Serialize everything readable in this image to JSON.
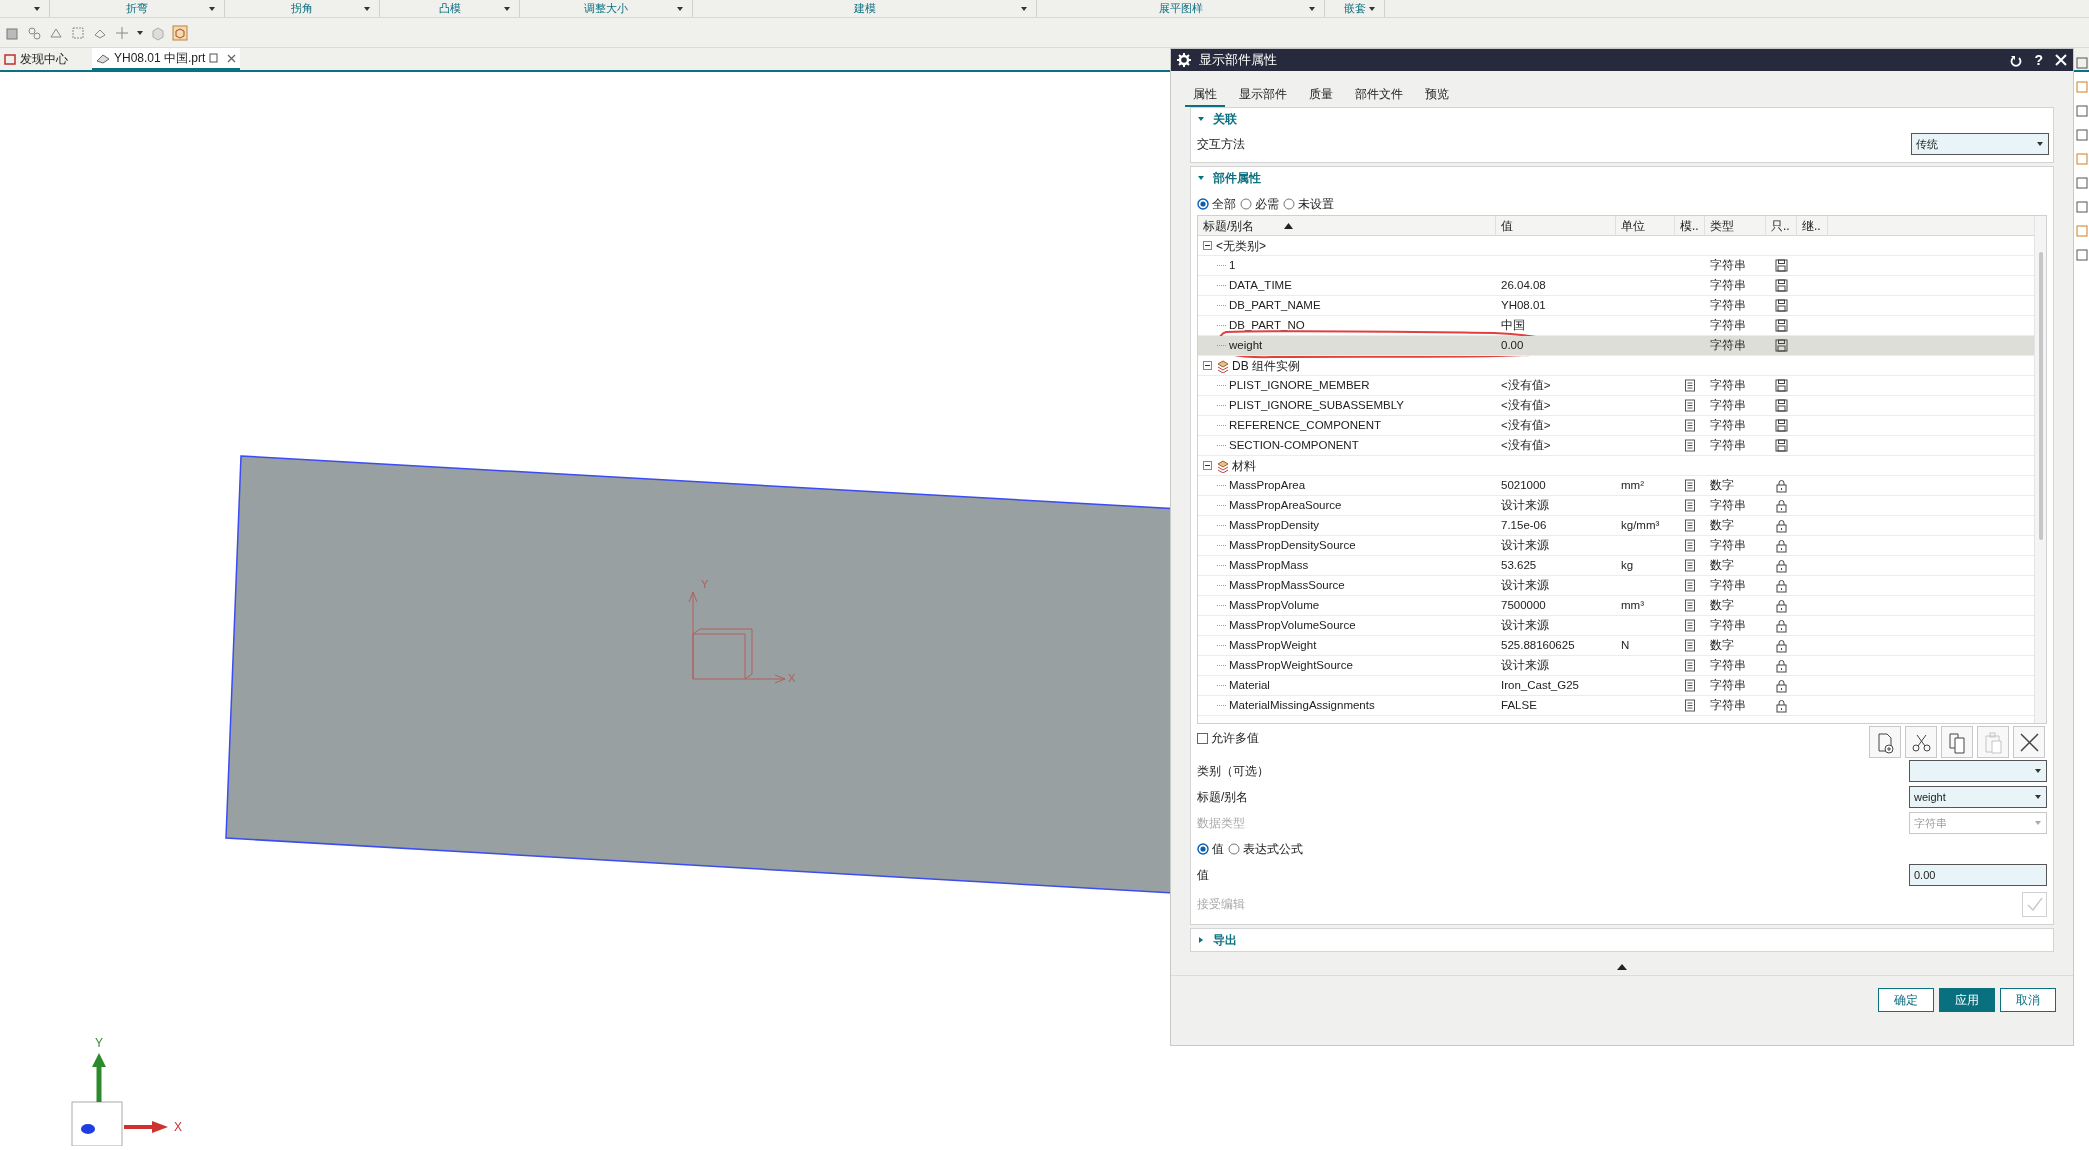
{
  "ribbon_groups": [
    "折弯",
    "拐角",
    "凸模",
    "调整大小",
    "建模",
    "展平图样",
    "嵌套"
  ],
  "doc_tabs": [
    {
      "label": "发现中心",
      "selected": false
    },
    {
      "label": "YH08.01 中国.prt",
      "selected": true
    }
  ],
  "viewport": {
    "center_triad": {
      "x": "X",
      "y": "Y"
    },
    "corner_triad": {
      "x": "X",
      "y": "Y"
    }
  },
  "dialog": {
    "title": "显示部件属性",
    "help": "?",
    "tabs": [
      {
        "label": "属性",
        "selected": true
      },
      {
        "label": "显示部件",
        "selected": false
      },
      {
        "label": "质量",
        "selected": false
      },
      {
        "label": "部件文件",
        "selected": false
      },
      {
        "label": "预览",
        "selected": false
      }
    ],
    "association": {
      "header": "关联",
      "expanded": true,
      "label": "交互方法",
      "value": "传统"
    },
    "part_attributes": {
      "header": "部件属性",
      "expanded": true,
      "filters": [
        {
          "label": "全部",
          "selected": true
        },
        {
          "label": "必需",
          "selected": false
        },
        {
          "label": "未设置",
          "selected": false
        }
      ],
      "columns": [
        "标题/别名",
        "值",
        "单位",
        "模..",
        "类型",
        "只..",
        "继.."
      ],
      "groups": [
        {
          "label": "<无类别>",
          "expanded": true,
          "children": [
            {
              "name": "1",
              "template": false,
              "type": "字符串",
              "locked": false,
              "selected": false,
              "circled": false
            },
            {
              "name": "DATA_TIME",
              "value": "26.04.08",
              "template": false,
              "type": "字符串",
              "locked": false,
              "selected": false,
              "circled": false
            },
            {
              "name": "DB_PART_NAME",
              "value": "YH08.01",
              "template": false,
              "type": "字符串",
              "locked": false,
              "selected": false,
              "circled": false
            },
            {
              "name": "DB_PART_NO",
              "value": "中国",
              "template": false,
              "type": "字符串",
              "locked": false,
              "selected": false,
              "circled": false
            },
            {
              "name": "weight",
              "value": "0.00",
              "template": false,
              "type": "字符串",
              "locked": false,
              "selected": true,
              "circled": true
            }
          ]
        },
        {
          "label": "DB 组件实例",
          "expanded": true,
          "children": [
            {
              "name": "PLIST_IGNORE_MEMBER",
              "value": "<没有值>",
              "template": true,
              "type": "字符串",
              "locked": false,
              "selected": false,
              "circled": false
            },
            {
              "name": "PLIST_IGNORE_SUBASSEMBLY",
              "value": "<没有值>",
              "template": true,
              "type": "字符串",
              "locked": false,
              "selected": false,
              "circled": false
            },
            {
              "name": "REFERENCE_COMPONENT",
              "value": "<没有值>",
              "template": true,
              "type": "字符串",
              "locked": false,
              "selected": false,
              "circled": false
            },
            {
              "name": "SECTION-COMPONENT",
              "value": "<没有值>",
              "template": true,
              "type": "字符串",
              "locked": false,
              "selected": false,
              "circled": false
            }
          ]
        },
        {
          "label": "材料",
          "expanded": true,
          "children": [
            {
              "name": "MassPropArea",
              "value": "5021000",
              "unit": "mm²",
              "template": true,
              "type": "数字",
              "locked": true,
              "selected": false,
              "circled": false
            },
            {
              "name": "MassPropAreaSource",
              "value": "设计来源",
              "template": true,
              "type": "字符串",
              "locked": true,
              "selected": false,
              "circled": false
            },
            {
              "name": "MassPropDensity",
              "value": "7.15e-06",
              "unit": "kg/mm³",
              "template": true,
              "type": "数字",
              "locked": true,
              "selected": false,
              "circled": false
            },
            {
              "name": "MassPropDensitySource",
              "value": "设计来源",
              "template": true,
              "type": "字符串",
              "locked": true,
              "selected": false,
              "circled": false
            },
            {
              "name": "MassPropMass",
              "value": "53.625",
              "unit": "kg",
              "template": true,
              "type": "数字",
              "locked": true,
              "selected": false,
              "circled": false
            },
            {
              "name": "MassPropMassSource",
              "value": "设计来源",
              "template": true,
              "type": "字符串",
              "locked": true,
              "selected": false,
              "circled": false
            },
            {
              "name": "MassPropVolume",
              "value": "7500000",
              "unit": "mm³",
              "template": true,
              "type": "数字",
              "locked": true,
              "selected": false,
              "circled": false
            },
            {
              "name": "MassPropVolumeSource",
              "value": "设计来源",
              "template": true,
              "type": "字符串",
              "locked": true,
              "selected": false,
              "circled": false
            },
            {
              "name": "MassPropWeight",
              "value": "525.88160625",
              "unit": "N",
              "template": true,
              "type": "数字",
              "locked": true,
              "selected": false,
              "circled": false
            },
            {
              "name": "MassPropWeightSource",
              "value": "设计来源",
              "template": true,
              "type": "字符串",
              "locked": true,
              "selected": false,
              "circled": false
            },
            {
              "name": "Material",
              "value": "Iron_Cast_G25",
              "template": true,
              "type": "字符串",
              "locked": true,
              "selected": false,
              "circled": false
            },
            {
              "name": "MaterialMissingAssignments",
              "value": "FALSE",
              "template": true,
              "type": "字符串",
              "locked": true,
              "selected": false,
              "circled": false
            }
          ]
        }
      ],
      "allow_multiple": {
        "label": "允许多值",
        "checked": false
      },
      "tool_buttons": [
        {
          "kind": "new",
          "disabled": false
        },
        {
          "kind": "cut",
          "disabled": false
        },
        {
          "kind": "copy",
          "disabled": false
        },
        {
          "kind": "paste",
          "disabled": true
        },
        {
          "kind": "delete",
          "disabled": false
        }
      ],
      "fields": [
        {
          "kind": "dropdown",
          "label": "类别（可选）",
          "disabled": false
        },
        {
          "kind": "dropdown",
          "label": "标题/别名",
          "value": "weight",
          "disabled": false
        },
        {
          "kind": "dropdown",
          "label": "数据类型",
          "value": "字符串",
          "disabled": true
        },
        {
          "kind": "radios",
          "options": [
            {
              "label": "值",
              "selected": true
            },
            {
              "label": "表达式公式",
              "selected": false
            }
          ]
        },
        {
          "kind": "input",
          "label": "值",
          "value": "0.00",
          "disabled": false
        },
        {
          "kind": "accept",
          "label": "接受编辑",
          "disabled": true
        }
      ]
    },
    "export": {
      "header": "导出",
      "expanded": false
    },
    "buttons": [
      {
        "label": "确定",
        "primary": false
      },
      {
        "label": "应用",
        "primary": true
      },
      {
        "label": "取消",
        "primary": false
      }
    ]
  }
}
